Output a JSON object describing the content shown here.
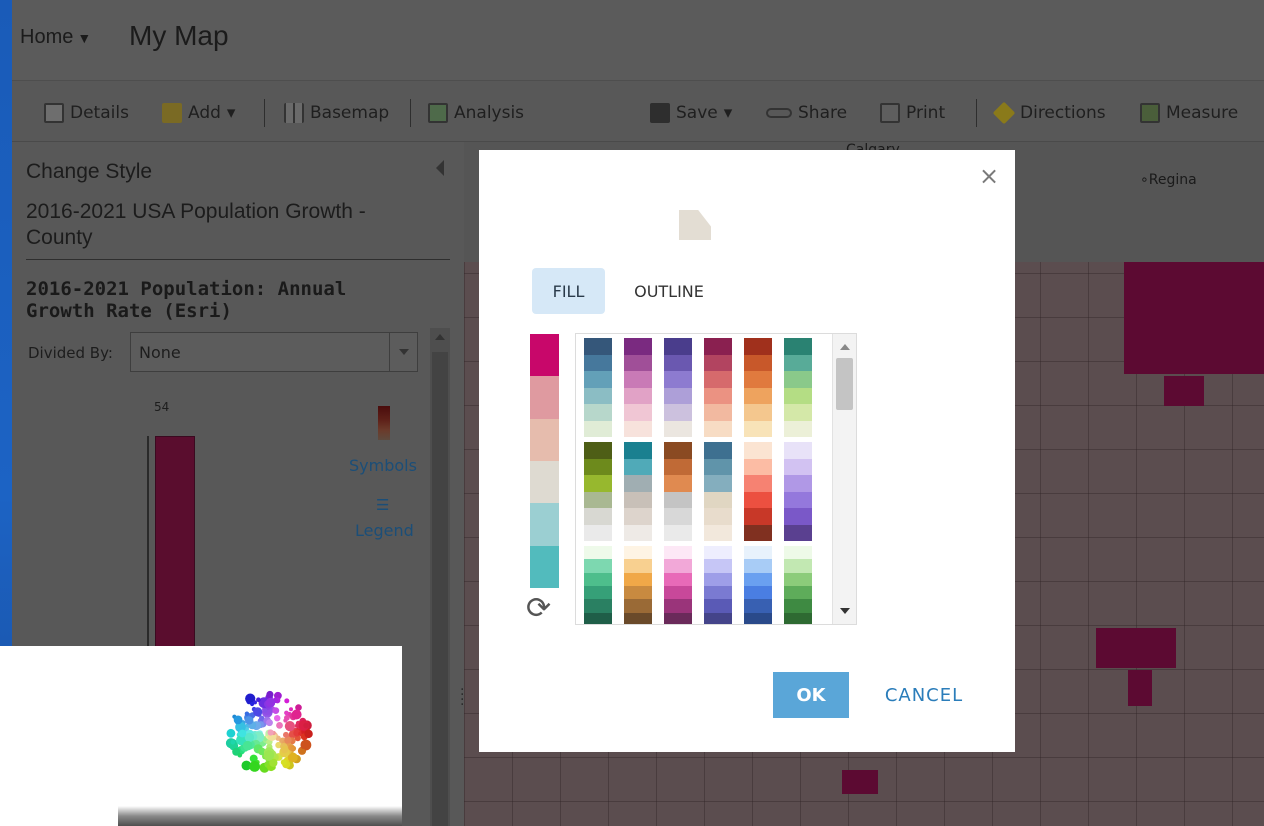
{
  "header": {
    "home_label": "Home",
    "home_caret": "▼",
    "map_title": "My Map"
  },
  "toolbar": {
    "details": "Details",
    "add": "Add",
    "basemap": "Basemap",
    "analysis": "Analysis",
    "save": "Save",
    "share": "Share",
    "print": "Print",
    "directions": "Directions",
    "measure": "Measure",
    "dropdown_caret": "▾",
    "icons": [
      "details-icon",
      "add-icon",
      "basemap-icon",
      "analysis-icon",
      "save-icon",
      "share-icon",
      "print-icon",
      "directions-icon",
      "measure-icon"
    ]
  },
  "panel": {
    "heading": "Change Style",
    "layer_name": "2016-2021 USA Population Growth - County",
    "attribute": "2016-2021 Population: Annual Growth Rate (Esri)",
    "divided_by_label": "Divided By:",
    "divided_by_value": "None",
    "histogram_max": "54",
    "symbols_link": "Symbols",
    "legend_link": "Legend"
  },
  "map": {
    "labels": {
      "city_top": "Calgary",
      "city_right": "Regina"
    }
  },
  "modal": {
    "close": "×",
    "tabs": {
      "fill": "FILL",
      "outline": "OUTLINE"
    },
    "selected_ramp": [
      "#c8076a",
      "#df9aa0",
      "#e6bcad",
      "#dedad1",
      "#9bcfd2",
      "#52bbbd"
    ],
    "ramps_row1": [
      [
        "#35577a",
        "#46789c",
        "#63a0b8",
        "#8bbdc4",
        "#b7d7cb",
        "#e0ecd6"
      ],
      [
        "#7a2a80",
        "#a04f98",
        "#c97ab6",
        "#e1a2c6",
        "#f0c6d4",
        "#f7e2dc"
      ],
      [
        "#4a3d8c",
        "#6a58b0",
        "#8d7bd0",
        "#ad9fd8",
        "#ccc1de",
        "#ebe6e0"
      ],
      [
        "#8a2050",
        "#b24460",
        "#d66a6c",
        "#eb9282",
        "#f2b9a0",
        "#f7dcc4"
      ],
      [
        "#a0301c",
        "#c8582a",
        "#e07a3e",
        "#eea35e",
        "#f4c78e",
        "#f8e3b8"
      ],
      [
        "#2a8272",
        "#58ab98",
        "#8ac98a",
        "#b4dd84",
        "#d4e8a8",
        "#ecf0d8"
      ]
    ],
    "ramps_row2": [
      [
        "#4e5e16",
        "#6d8a1c",
        "#97b82e",
        "#a9b892",
        "#d8d8d2",
        "#eaeaea"
      ],
      [
        "#1a8090",
        "#50aab8",
        "#a0aeb2",
        "#c8c0b8",
        "#ddd4cc",
        "#eeeae6"
      ],
      [
        "#8a4a22",
        "#c06a36",
        "#e08a50",
        "#c4c4c4",
        "#d8d8d8",
        "#eaeaea"
      ],
      [
        "#3e7090",
        "#6094aa",
        "#84aebe",
        "#e0d6c2",
        "#e8dccc",
        "#f2e8dc"
      ],
      [
        "#fbe4d2",
        "#fcbca4",
        "#f68272",
        "#ec5040",
        "#c83828",
        "#803020"
      ],
      [
        "#e8e2f8",
        "#d2c2f2",
        "#b098e6",
        "#9478dc",
        "#7a58c8",
        "#5a4090"
      ]
    ],
    "ramps_row3": [
      [
        "#eefaea",
        "#7dd8b0",
        "#4ebe8c",
        "#36a078",
        "#2a8062",
        "#1f5e48"
      ],
      [
        "#fef4e4",
        "#f8d090",
        "#f0a848",
        "#c88a40",
        "#9a6a36",
        "#6a4a2a"
      ],
      [
        "#fde8f6",
        "#f2a8d8",
        "#e86ab8",
        "#c8489a",
        "#9a347a",
        "#6a2a5a"
      ],
      [
        "#eeeefe",
        "#c6c6f6",
        "#9e9ee8",
        "#7a7ad2",
        "#5a5ab6",
        "#44448a"
      ],
      [
        "#e8f2fc",
        "#a8ccf6",
        "#6aa0f0",
        "#4a7ee2",
        "#3860b2",
        "#2a4a8a"
      ],
      [
        "#eefae8",
        "#c2e8b2",
        "#8ccc7a",
        "#5eac5a",
        "#3e8a42",
        "#2e6a32"
      ]
    ],
    "ok_label": "OK",
    "cancel_label": "CANCEL",
    "refresh_icon": "⟳"
  }
}
